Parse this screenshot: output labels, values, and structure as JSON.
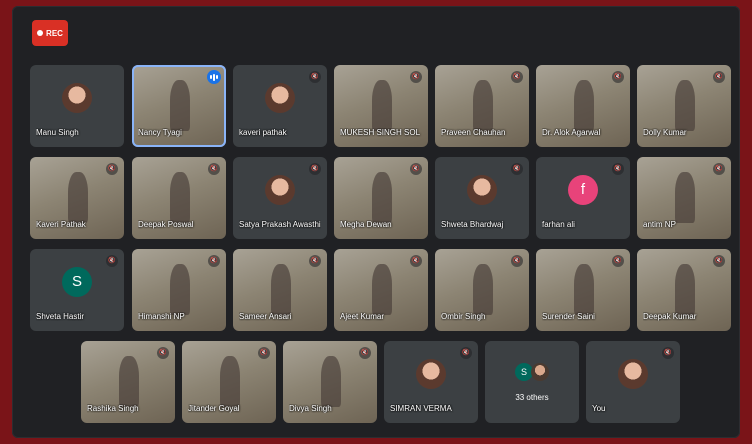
{
  "recording": {
    "label": "REC"
  },
  "participants": [
    {
      "name": "Manu Singh",
      "kind": "avatar",
      "muted": false
    },
    {
      "name": "Nancy Tyagi",
      "kind": "video",
      "muted": false,
      "speaking": true
    },
    {
      "name": "kaveri pathak",
      "kind": "avatar",
      "muted": true
    },
    {
      "name": "MUKESH SINGH SOL",
      "kind": "video",
      "muted": true
    },
    {
      "name": "Praveen Chauhan",
      "kind": "video",
      "muted": true
    },
    {
      "name": "Dr. Alok Agarwal",
      "kind": "video",
      "muted": true
    },
    {
      "name": "Dolly Kumar",
      "kind": "video",
      "muted": true
    },
    {
      "name": "Kaveri Pathak",
      "kind": "video",
      "muted": true
    },
    {
      "name": "Deepak Poswal",
      "kind": "video",
      "muted": true
    },
    {
      "name": "Satya Prakash Awasthi",
      "kind": "avatar",
      "muted": true
    },
    {
      "name": "Megha Dewan",
      "kind": "video",
      "muted": true
    },
    {
      "name": "Shweta Bhardwaj",
      "kind": "avatar",
      "muted": true
    },
    {
      "name": "farhan ali",
      "kind": "letter",
      "letter": "f",
      "color": "#e8437a",
      "muted": true
    },
    {
      "name": "antim NP",
      "kind": "video",
      "muted": true
    },
    {
      "name": "Shveta Hastir",
      "kind": "letter",
      "letter": "S",
      "color": "#00695c",
      "muted": true
    },
    {
      "name": "Himanshi NP",
      "kind": "video",
      "muted": true
    },
    {
      "name": "Sameer Ansari",
      "kind": "video",
      "muted": true
    },
    {
      "name": "Ajeet Kumar",
      "kind": "video",
      "muted": true
    },
    {
      "name": "Ombir Singh",
      "kind": "video",
      "muted": true
    },
    {
      "name": "Surender Saini",
      "kind": "video",
      "muted": true
    },
    {
      "name": "Deepak Kumar",
      "kind": "video",
      "muted": true
    },
    {
      "name": "Rashika Singh",
      "kind": "video",
      "muted": true
    },
    {
      "name": "Jitander Goyal",
      "kind": "video",
      "muted": true
    },
    {
      "name": "Divya Singh",
      "kind": "video",
      "muted": true
    },
    {
      "name": "SIMRAN VERMA",
      "kind": "avatar",
      "muted": true
    },
    {
      "name": "You",
      "kind": "avatar",
      "muted": true
    }
  ],
  "others": {
    "label": "33 others",
    "letter": "S",
    "color": "#00695c"
  },
  "icons": {
    "mic_off": "mic-off-icon",
    "speaking": "audio-level-icon",
    "record": "record-dot-icon"
  }
}
